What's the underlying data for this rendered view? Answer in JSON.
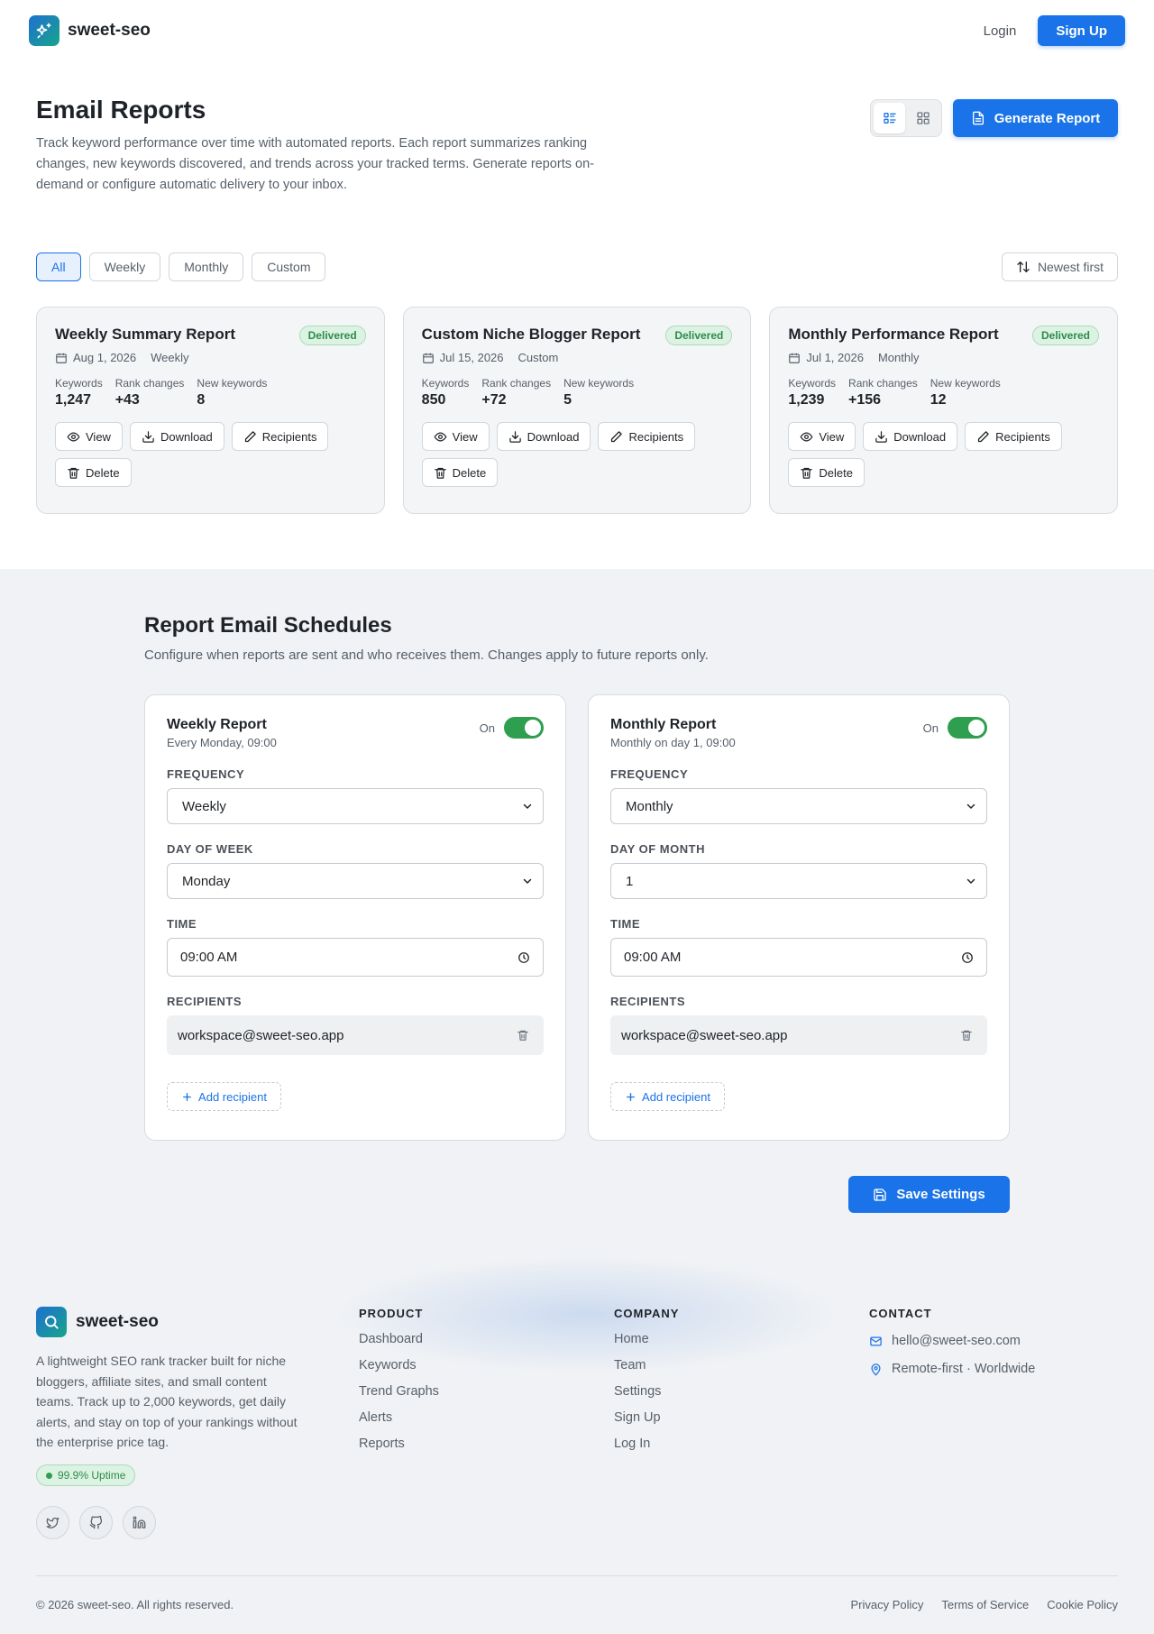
{
  "header": {
    "brand": "sweet-seo",
    "login": "Login",
    "signup": "Sign Up"
  },
  "hero": {
    "title": "Email Reports",
    "description": "Track keyword performance over time with automated reports. Each report summarizes ranking changes, new keywords discovered, and trends across your tracked terms. Generate reports on-demand or configure automatic delivery to your inbox.",
    "generate_label": "Generate Report",
    "view_mode": "list"
  },
  "filters": {
    "chips": [
      "All",
      "Weekly",
      "Monthly",
      "Custom"
    ],
    "active": "All",
    "sort_label": "Newest first"
  },
  "reports": [
    {
      "title": "Weekly Summary Report",
      "status": "Delivered",
      "date": "Aug 1, 2026",
      "type": "Weekly",
      "stats": [
        {
          "label": "Keywords",
          "value": "1,247"
        },
        {
          "label": "Rank changes",
          "value": "+43"
        },
        {
          "label": "New keywords",
          "value": "8"
        }
      ]
    },
    {
      "title": "Custom Niche Blogger Report",
      "status": "Delivered",
      "date": "Jul 15, 2026",
      "type": "Custom",
      "stats": [
        {
          "label": "Keywords",
          "value": "850"
        },
        {
          "label": "Rank changes",
          "value": "+72"
        },
        {
          "label": "New keywords",
          "value": "5"
        }
      ]
    },
    {
      "title": "Monthly Performance Report",
      "status": "Delivered",
      "date": "Jul 1, 2026",
      "type": "Monthly",
      "stats": [
        {
          "label": "Keywords",
          "value": "1,239"
        },
        {
          "label": "Rank changes",
          "value": "+156"
        },
        {
          "label": "New keywords",
          "value": "12"
        }
      ]
    }
  ],
  "report_actions": {
    "view": "View",
    "download": "Download",
    "recipients": "Recipients",
    "delete": "Delete"
  },
  "schedules": {
    "title": "Report Email Schedules",
    "description": "Configure when reports are sent and who receives them. Changes apply to future reports only.",
    "toggle_label": "On",
    "frequency_label": "FREQUENCY",
    "time_label": "TIME",
    "recipients_label": "RECIPIENTS",
    "add_recipient": "Add recipient",
    "save_label": "Save Settings",
    "cards": [
      {
        "title": "Weekly Report",
        "subtitle": "Every Monday, 09:00",
        "enabled": true,
        "frequency": "Weekly",
        "day_label": "DAY OF WEEK",
        "day_value": "Monday",
        "time": "09:00 AM",
        "recipients": [
          "workspace@sweet-seo.app"
        ]
      },
      {
        "title": "Monthly Report",
        "subtitle": "Monthly on day 1, 09:00",
        "enabled": true,
        "frequency": "Monthly",
        "day_label": "DAY OF MONTH",
        "day_value": "1",
        "time": "09:00 AM",
        "recipients": [
          "workspace@sweet-seo.app"
        ]
      }
    ]
  },
  "footer": {
    "brand": "sweet-seo",
    "description": "A lightweight SEO rank tracker built for niche bloggers, affiliate sites, and small content teams. Track up to 2,000 keywords, get daily alerts, and stay on top of your rankings without the enterprise price tag.",
    "uptime": "99.9% Uptime",
    "product_title": "PRODUCT",
    "product_links": [
      "Dashboard",
      "Keywords",
      "Trend Graphs",
      "Alerts",
      "Reports"
    ],
    "company_title": "COMPANY",
    "company_links": [
      "Home",
      "Team",
      "Settings",
      "Sign Up",
      "Log In"
    ],
    "contact_title": "CONTACT",
    "email": "hello@sweet-seo.com",
    "location": "Remote-first · Worldwide",
    "copyright": "© 2026 sweet-seo. All rights reserved.",
    "legal": [
      "Privacy Policy",
      "Terms of Service",
      "Cookie Policy"
    ]
  },
  "colors": {
    "accent": "#1a73e8",
    "success": "#2e9e4f",
    "section_bg": "#f0f2f5"
  }
}
